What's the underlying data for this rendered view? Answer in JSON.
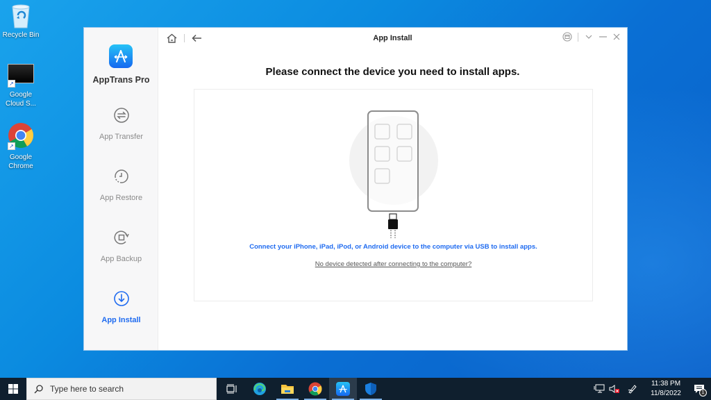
{
  "desktop": {
    "icons": [
      {
        "label": "Recycle Bin",
        "icon": "recycle-bin-icon"
      },
      {
        "label": "Google Cloud S...",
        "icon": "terminal-icon"
      },
      {
        "label": "Google Chrome",
        "icon": "chrome-icon"
      }
    ]
  },
  "app": {
    "name": "AppTrans Pro",
    "window_title": "App Install",
    "accent_color": "#1f6bf0",
    "nav": [
      {
        "label": "App Transfer",
        "icon": "transfer-icon",
        "active": false
      },
      {
        "label": "App Restore",
        "icon": "restore-clock-icon",
        "active": false
      },
      {
        "label": "App Backup",
        "icon": "backup-icon",
        "active": false
      },
      {
        "label": "App Install",
        "icon": "download-icon",
        "active": true
      }
    ],
    "topbar": {
      "home_icon": "home-icon",
      "back_icon": "back-arrow-icon"
    },
    "window_controls": [
      "feedback-icon",
      "menu-chevron-icon",
      "minimize-icon",
      "close-icon"
    ]
  },
  "main": {
    "heading": "Please connect the device you need to install apps.",
    "connect_text": "Connect your iPhone, iPad, iPod, or Android device to the computer via USB to install apps.",
    "help_link": "No device detected after connecting to the computer?"
  },
  "taskbar": {
    "search_placeholder": "Type here to search",
    "apps": [
      "task-view-icon",
      "edge-icon",
      "file-explorer-icon",
      "chrome-icon",
      "apptrans-icon",
      "defender-icon"
    ],
    "time": "11:38 PM",
    "date": "11/8/2022",
    "notification_count": "1"
  }
}
